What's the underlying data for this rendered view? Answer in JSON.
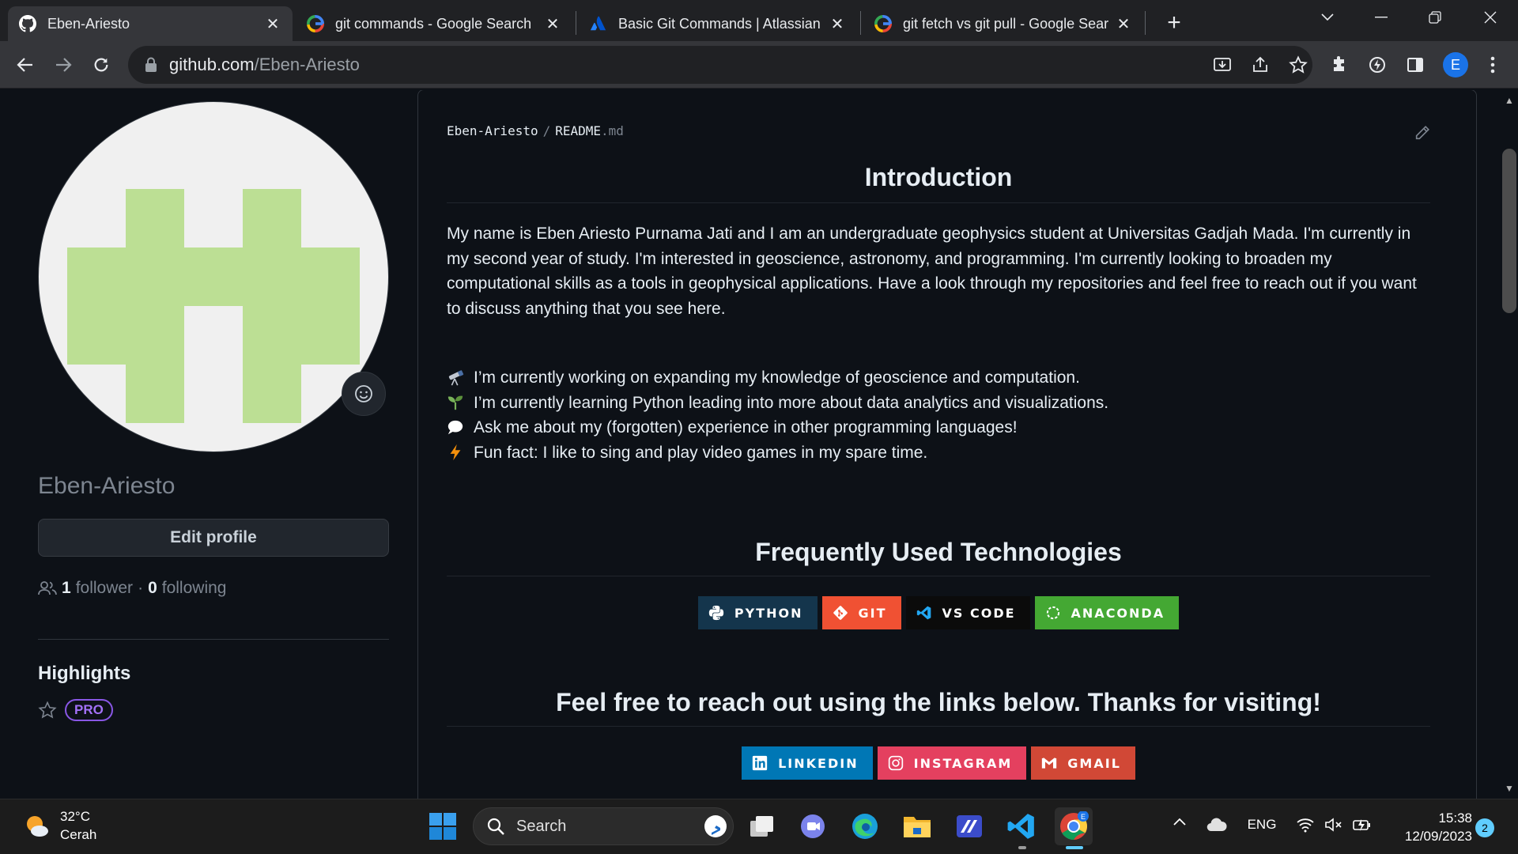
{
  "browser": {
    "tabs": [
      {
        "title": "Eben-Ariesto",
        "icon": "github-icon",
        "active": true
      },
      {
        "title": "git commands - Google Search",
        "icon": "google-icon",
        "active": false
      },
      {
        "title": "Basic Git Commands | Atlassian G",
        "icon": "atlassian-icon",
        "active": false
      },
      {
        "title": "git fetch vs git pull - Google Sear",
        "icon": "google-icon",
        "active": false
      }
    ],
    "url_host": "github.com",
    "url_path": "/Eben-Ariesto",
    "profile_initial": "E"
  },
  "profile": {
    "username": "Eben-Ariesto",
    "edit_label": "Edit profile",
    "followers_count": "1",
    "followers_label": "follower",
    "separator": "·",
    "following_count": "0",
    "following_label": "following",
    "highlights_title": "Highlights",
    "pro_label": "PRO"
  },
  "readme": {
    "owner": "Eben-Ariesto",
    "path_sep": "/",
    "file_name": "README",
    "file_ext": ".md",
    "intro_heading": "Introduction",
    "intro_paragraph": "My name is Eben Ariesto Purnama Jati and I am an undergraduate geophysics student at Universitas Gadjah Mada. I'm currently in my second year of study. I'm interested in geoscience, astronomy, and programming. I'm currently looking to broaden my computational skills as a tools in geophysical applications. Have a look through my repositories and feel free to reach out if you want to discuss anything that you see here.",
    "bullets": [
      {
        "icon": "telescope-icon",
        "text": "I’m currently working on expanding my knowledge of geoscience and computation."
      },
      {
        "icon": "seedling-icon",
        "text": "I’m currently learning Python leading into more about data analytics and visualizations."
      },
      {
        "icon": "speech-bubble-icon",
        "text": "Ask me about my (forgotten) experience in other programming languages!"
      },
      {
        "icon": "lightning-icon",
        "text": "Fun fact: I like to sing and play video games in my spare time."
      }
    ],
    "tech_heading": "Frequently Used Technologies",
    "tech_badges": [
      {
        "label": "PYTHON",
        "color": "#14354c"
      },
      {
        "label": "GIT",
        "color": "#f05133"
      },
      {
        "label": "VS CODE",
        "color": "#0b0b0b"
      },
      {
        "label": "ANACONDA",
        "color": "#44a833"
      }
    ],
    "reach_heading": "Feel free to reach out using the links below. Thanks for visiting!",
    "social_badges": [
      {
        "label": "LINKEDIN",
        "color": "#0077b5"
      },
      {
        "label": "INSTAGRAM",
        "color": "#e4405f"
      },
      {
        "label": "GMAIL",
        "color": "#d14836"
      }
    ]
  },
  "taskbar": {
    "temperature": "32°C",
    "weather_text": "Cerah",
    "search_placeholder": "Search",
    "language": "ENG",
    "time": "15:38",
    "date": "12/09/2023",
    "notifications": "2"
  },
  "colors": {
    "page_bg": "#0d1117",
    "avatar_green": "#bcdf94",
    "pro_purple": "#a371f7",
    "accent_blue": "#60cdff"
  }
}
